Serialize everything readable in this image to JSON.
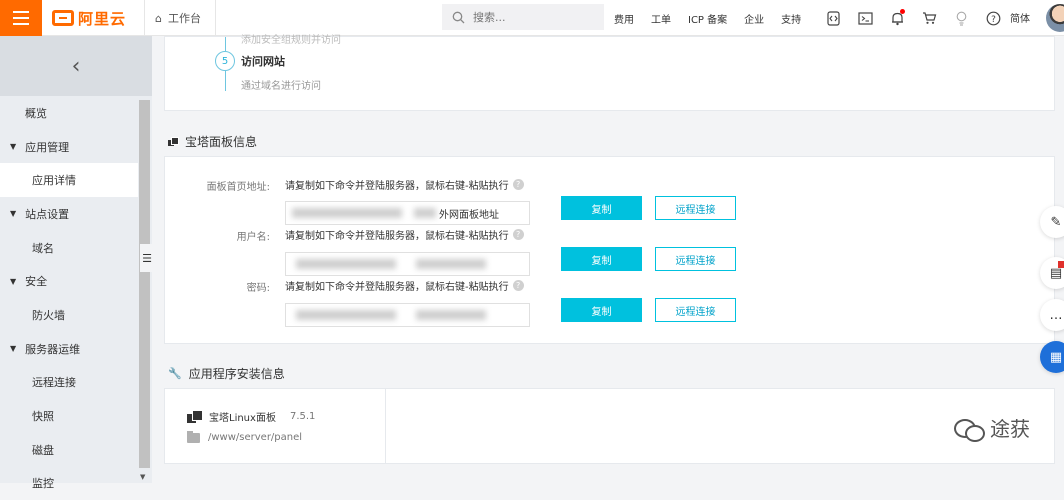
{
  "topbar": {
    "logo_text": "阿里云",
    "workbench_label": "工作台",
    "search_placeholder": "搜索...",
    "links": [
      "费用",
      "工单",
      "ICP 备案",
      "企业",
      "支持"
    ],
    "lang": "简体",
    "icons": [
      "code-icon",
      "terminal-icon",
      "bell-icon",
      "cart-icon",
      "bulb-icon",
      "help-icon"
    ]
  },
  "sidebar": {
    "items": [
      {
        "label": "概览",
        "kind": "item"
      },
      {
        "label": "应用管理",
        "kind": "group"
      },
      {
        "label": "应用详情",
        "kind": "sub",
        "active": true
      },
      {
        "label": "站点设置",
        "kind": "group"
      },
      {
        "label": "域名",
        "kind": "sub"
      },
      {
        "label": "安全",
        "kind": "group"
      },
      {
        "label": "防火墙",
        "kind": "sub"
      },
      {
        "label": "服务器运维",
        "kind": "group"
      },
      {
        "label": "远程连接",
        "kind": "sub"
      },
      {
        "label": "快照",
        "kind": "sub"
      },
      {
        "label": "磁盘",
        "kind": "sub"
      },
      {
        "label": "监控",
        "kind": "sub"
      }
    ]
  },
  "steps": {
    "cut_text": "添加安全组规则并访问",
    "step_number": "5",
    "step_title": "访问网站",
    "step_desc": "通过域名进行访问"
  },
  "panel": {
    "title": "宝塔面板信息",
    "rows": [
      {
        "label": "面板首页地址:",
        "hint": "请复制如下命令并登陆服务器，鼠标右键-粘贴执行",
        "field_tail": "外网面板地址",
        "copy": "复制",
        "remote": "远程连接"
      },
      {
        "label": "用户名:",
        "hint": "请复制如下命令并登陆服务器，鼠标右键-粘贴执行",
        "field_tail": "",
        "copy": "复制",
        "remote": "远程连接"
      },
      {
        "label": "密码:",
        "hint": "请复制如下命令并登陆服务器，鼠标右键-粘贴执行",
        "field_tail": "",
        "copy": "复制",
        "remote": "远程连接"
      }
    ]
  },
  "apps": {
    "title": "应用程序安装信息",
    "name": "宝塔Linux面板",
    "version": "7.5.1",
    "path": "/www/server/panel"
  },
  "watermark": {
    "text": "途获"
  }
}
